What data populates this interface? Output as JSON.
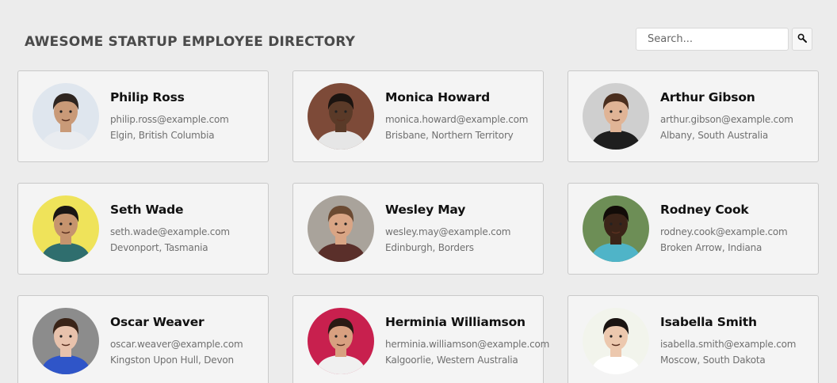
{
  "header": {
    "title": "AWESOME STARTUP EMPLOYEE DIRECTORY"
  },
  "search": {
    "placeholder": "Search...",
    "value": "",
    "button_icon": "search-icon"
  },
  "employees": [
    {
      "name": "Philip Ross",
      "email": "philip.ross@example.com",
      "location": "Elgin, British Columbia",
      "avatar_colors": {
        "bg": "#dfe6ee",
        "skin": "#c99a78",
        "hair": "#2e2520",
        "shirt": "#e9ecf0"
      }
    },
    {
      "name": "Monica Howard",
      "email": "monica.howard@example.com",
      "location": "Brisbane, Northern Territory",
      "avatar_colors": {
        "bg": "#7d4a38",
        "skin": "#5a3a28",
        "hair": "#1c1410",
        "shirt": "#e6e6e6"
      }
    },
    {
      "name": "Arthur Gibson",
      "email": "arthur.gibson@example.com",
      "location": "Albany, South Australia",
      "avatar_colors": {
        "bg": "#cfcfcf",
        "skin": "#e0b496",
        "hair": "#4a2e1e",
        "shirt": "#1e1e1e"
      }
    },
    {
      "name": "Seth Wade",
      "email": "seth.wade@example.com",
      "location": "Devonport, Tasmania",
      "avatar_colors": {
        "bg": "#efe35a",
        "skin": "#c6946e",
        "hair": "#1a1614",
        "shirt": "#2f6e6e"
      }
    },
    {
      "name": "Wesley May",
      "email": "wesley.may@example.com",
      "location": "Edinburgh, Borders",
      "avatar_colors": {
        "bg": "#a9a39b",
        "skin": "#d9a585",
        "hair": "#6b4a32",
        "shirt": "#5a2f2a"
      }
    },
    {
      "name": "Rodney Cook",
      "email": "rodney.cook@example.com",
      "location": "Broken Arrow, Indiana",
      "avatar_colors": {
        "bg": "#6d8e56",
        "skin": "#3b2418",
        "hair": "#120c08",
        "shirt": "#4fb4c8"
      }
    },
    {
      "name": "Oscar Weaver",
      "email": "oscar.weaver@example.com",
      "location": "Kingston Upon Hull, Devon",
      "avatar_colors": {
        "bg": "#8c8c8c",
        "skin": "#e8c2ac",
        "hair": "#3a2418",
        "shirt": "#2f55c8"
      }
    },
    {
      "name": "Herminia Williamson",
      "email": "herminia.williamson@example.com",
      "location": "Kalgoorlie, Western Australia",
      "avatar_colors": {
        "bg": "#c8204e",
        "skin": "#d8a080",
        "hair": "#2a1a14",
        "shirt": "#f0f0f0"
      }
    },
    {
      "name": "Isabella Smith",
      "email": "isabella.smith@example.com",
      "location": "Moscow, South Dakota",
      "avatar_colors": {
        "bg": "#f2f4ec",
        "skin": "#ecc8ae",
        "hair": "#1a1412",
        "shirt": "#ffffff"
      }
    }
  ]
}
